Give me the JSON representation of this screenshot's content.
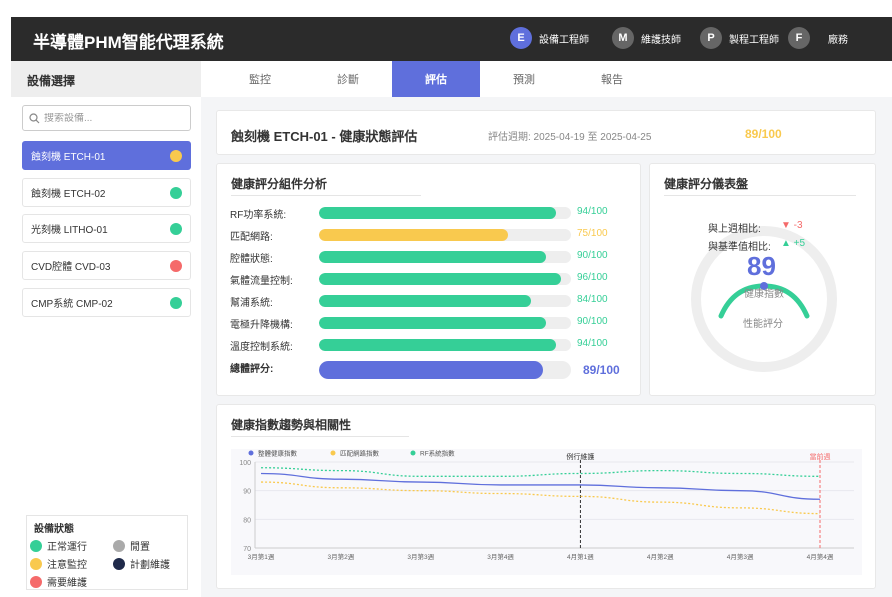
{
  "app": {
    "title": "半導體PHM智能代理系統",
    "roles": [
      {
        "initial": "E",
        "label": "設備工程師",
        "color": "#5f6fdc"
      },
      {
        "initial": "M",
        "label": "維護技師",
        "color": "#666666"
      },
      {
        "initial": "P",
        "label": "製程工程師",
        "color": "#666666"
      },
      {
        "initial": "F",
        "label": "廠務",
        "color": "#666666"
      }
    ]
  },
  "sidebar": {
    "title": "設備選擇",
    "search_placeholder": "搜索設備...",
    "equipment": [
      {
        "name": "蝕刻機 ETCH-01",
        "status_color": "#f9c94e",
        "active": true
      },
      {
        "name": "蝕刻機 ETCH-02",
        "status_color": "#35cf97",
        "active": false
      },
      {
        "name": "光刻機 LITHO-01",
        "status_color": "#35cf97",
        "active": false
      },
      {
        "name": "CVD腔體 CVD-03",
        "status_color": "#f56a6a",
        "active": false
      },
      {
        "name": "CMP系統 CMP-02",
        "status_color": "#35cf97",
        "active": false
      }
    ],
    "legend": {
      "title": "設備狀態",
      "items": [
        {
          "label": "正常運行",
          "color": "#35cf97"
        },
        {
          "label": "閒置",
          "color": "#aaaaaa"
        },
        {
          "label": "注意監控",
          "color": "#f9c94e"
        },
        {
          "label": "計劃維護",
          "color": "#1f2a4a"
        },
        {
          "label": "需要維護",
          "color": "#f56a6a"
        }
      ]
    }
  },
  "tabs": [
    "監控",
    "診斷",
    "評估",
    "預測",
    "報告"
  ],
  "active_tab": "評估",
  "header": {
    "title": "蝕刻機 ETCH-01 - 健康狀態評估",
    "period": "評估週期: 2025-04-19 至 2025-04-25",
    "score": "89/100"
  },
  "components": {
    "title": "健康評分組件分析",
    "items": [
      {
        "label": "RF功率系統:",
        "value": 94,
        "score": "94/100",
        "color": "#35cf97"
      },
      {
        "label": "匹配網路:",
        "value": 75,
        "score": "75/100",
        "color": "#f9c94e"
      },
      {
        "label": "腔體狀態:",
        "value": 90,
        "score": "90/100",
        "color": "#35cf97"
      },
      {
        "label": "氣體流量控制:",
        "value": 96,
        "score": "96/100",
        "color": "#35cf97"
      },
      {
        "label": "幫浦系統:",
        "value": 84,
        "score": "84/100",
        "color": "#35cf97"
      },
      {
        "label": "電極升降機構:",
        "value": 90,
        "score": "90/100",
        "color": "#35cf97"
      },
      {
        "label": "溫度控制系統:",
        "value": 94,
        "score": "94/100",
        "color": "#35cf97"
      }
    ],
    "total": {
      "label": "總體評分:",
      "value": 89,
      "score": "89/100",
      "color": "#5f6fdc"
    }
  },
  "gauge": {
    "title": "健康評分儀表盤",
    "vs_last_week_label": "與上週相比:",
    "vs_last_week_value": "▼ -3",
    "vs_baseline_label": "與基準值相比:",
    "vs_baseline_value": "▲ +5",
    "value": 89,
    "value_text": "89",
    "sub_label": "健康指數",
    "perf_label": "性能評分"
  },
  "trend": {
    "title": "健康指數趨勢與相關性"
  },
  "chart_data": {
    "type": "line",
    "title": "",
    "legend": [
      "整體健康指數",
      "匹配網路指數",
      "RF系統指數"
    ],
    "x": [
      "3月第1週",
      "3月第2週",
      "3月第3週",
      "3月第4週",
      "4月第1週",
      "4月第2週",
      "4月第3週",
      "4月第4週"
    ],
    "ylim": [
      70,
      100
    ],
    "yticks": [
      70,
      80,
      90,
      100
    ],
    "series": [
      {
        "name": "整體健康指數",
        "color": "#5f6fdc",
        "values": [
          96,
          94,
          93,
          92,
          92,
          91,
          90,
          87
        ]
      },
      {
        "name": "匹配網路指數",
        "color": "#f9c94e",
        "values": [
          93,
          91,
          90,
          89,
          88,
          86,
          84,
          82
        ]
      },
      {
        "name": "RF系統指數",
        "color": "#35cf97",
        "values": [
          98,
          97,
          95,
          95,
          96,
          97,
          96,
          95
        ]
      }
    ],
    "annotations": [
      {
        "label": "例行維護",
        "x_index": 4,
        "color": "#333333"
      },
      {
        "label": "當前週",
        "x_index": 7,
        "color": "#f56a6a"
      }
    ],
    "grid": true,
    "legend_placement": "top-left"
  }
}
